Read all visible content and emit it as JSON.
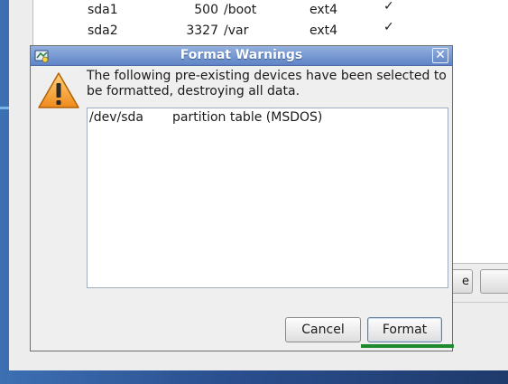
{
  "background_window": {
    "partitions": [
      {
        "device": "sda1",
        "size": "500",
        "mount": "/boot",
        "fs": "ext4",
        "format_mark": "✓"
      },
      {
        "device": "sda2",
        "size": "3327",
        "mount": "/var",
        "fs": "ext4",
        "format_mark": "✓"
      }
    ],
    "partial_button_label": "e"
  },
  "dialog": {
    "title": "Format Warnings",
    "close_glyph": "✕",
    "message": "The following pre-existing devices have been selected to be formatted, destroying all data.",
    "devices": [
      {
        "device": "/dev/sda",
        "description": "partition table (MSDOS)"
      }
    ],
    "buttons": {
      "cancel": "Cancel",
      "format": "Format"
    }
  },
  "colors": {
    "titlebar": "#6f90cf",
    "focus_indicator": "#1d8a2e",
    "warning": "#f2a13a"
  }
}
